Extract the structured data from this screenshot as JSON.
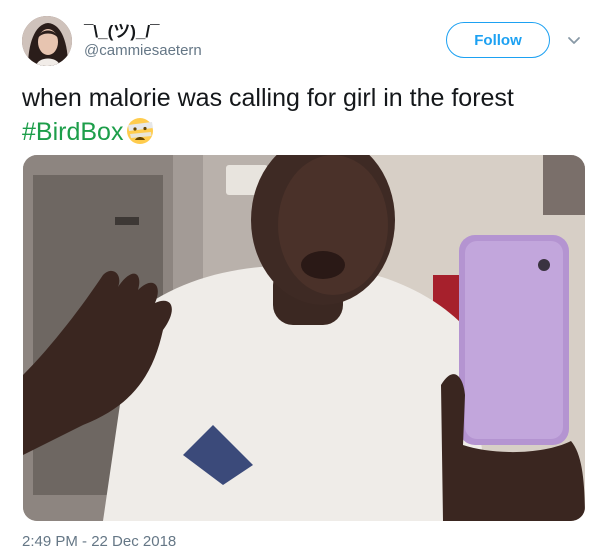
{
  "tweet": {
    "display_name": "¯\\_(ツ)_/¯",
    "handle": "@cammiesaetern",
    "follow_label": "Follow",
    "text": "when malorie was calling for girl in the forest",
    "hashtag": "#BirdBox",
    "emoji_name": "face-with-head-bandage-emoji",
    "timestamp": "2:49 PM - 22 Dec 2018"
  },
  "colors": {
    "follow_blue": "#1da1f2",
    "hashtag_green": "#1d9e4a",
    "secondary_text": "#657786"
  },
  "icons": {
    "more_menu": "chevron-down-icon"
  }
}
